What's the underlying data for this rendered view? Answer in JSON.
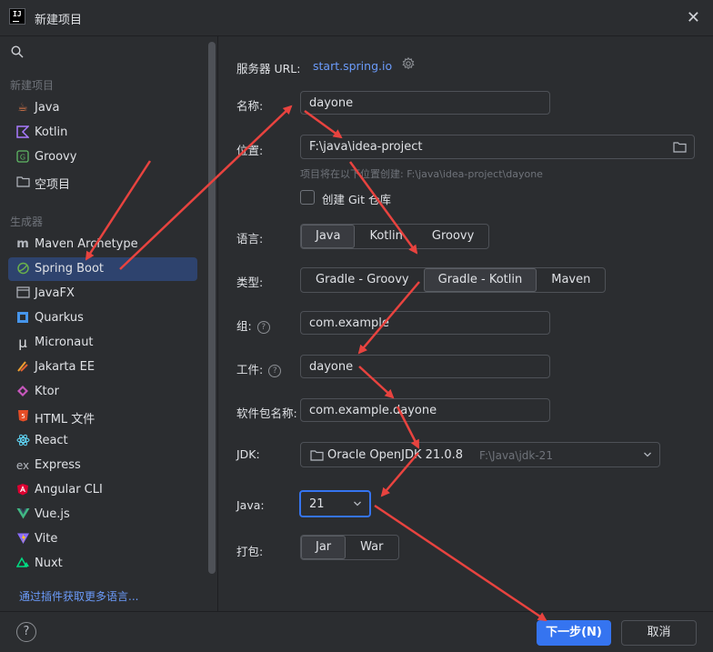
{
  "window": {
    "title": "新建项目",
    "close_icon": "close-icon"
  },
  "sidebar": {
    "section_new": "新建项目",
    "new_items": [
      {
        "label": "Java",
        "icon": "java-cup-icon"
      },
      {
        "label": "Kotlin",
        "icon": "kotlin-icon"
      },
      {
        "label": "Groovy",
        "icon": "groovy-icon"
      },
      {
        "label": "空项目",
        "icon": "empty-project-icon"
      }
    ],
    "section_generators": "生成器",
    "generator_items": [
      {
        "label": "Maven Archetype",
        "icon": "maven-icon"
      },
      {
        "label": "Spring Boot",
        "icon": "spring-icon"
      },
      {
        "label": "JavaFX",
        "icon": "javafx-icon"
      },
      {
        "label": "Quarkus",
        "icon": "quarkus-icon"
      },
      {
        "label": "Micronaut",
        "icon": "micronaut-icon"
      },
      {
        "label": "Jakarta EE",
        "icon": "jakarta-icon"
      },
      {
        "label": "Ktor",
        "icon": "ktor-icon"
      },
      {
        "label": "HTML 文件",
        "icon": "html5-icon"
      },
      {
        "label": "React",
        "icon": "react-icon"
      },
      {
        "label": "Express",
        "icon": "express-icon"
      },
      {
        "label": "Angular CLI",
        "icon": "angular-icon"
      },
      {
        "label": "Vue.js",
        "icon": "vue-icon"
      },
      {
        "label": "Vite",
        "icon": "vite-icon"
      },
      {
        "label": "Nuxt",
        "icon": "nuxt-icon"
      }
    ],
    "selected": "Spring Boot",
    "plugin_link": "通过插件获取更多语言..."
  },
  "form": {
    "server_url_label": "服务器 URL:",
    "server_url": "start.spring.io",
    "name_label": "名称:",
    "name_value": "dayone",
    "location_label": "位置:",
    "location_value": "F:\\java\\idea-project",
    "location_hint": "项目将在以下位置创建: F:\\java\\idea-project\\dayone",
    "git_label": "创建 Git 仓库",
    "git_checked": false,
    "language_label": "语言:",
    "languages": [
      "Java",
      "Kotlin",
      "Groovy"
    ],
    "language_selected": "Java",
    "type_label": "类型:",
    "types": [
      "Gradle - Groovy",
      "Gradle - Kotlin",
      "Maven"
    ],
    "type_selected": "Gradle - Kotlin",
    "group_label": "组:",
    "group_value": "com.example",
    "artifact_label": "工件:",
    "artifact_value": "dayone",
    "package_label": "软件包名称:",
    "package_value": "com.example.dayone",
    "jdk_label": "JDK:",
    "jdk_name": "Oracle OpenJDK 21.0.8",
    "jdk_path": "F:\\Java\\jdk-21",
    "java_label": "Java:",
    "java_value": "21",
    "packaging_label": "打包:",
    "packagings": [
      "Jar",
      "War"
    ],
    "packaging_selected": "Jar"
  },
  "footer": {
    "help": "?",
    "next_label": "下一步(N)",
    "cancel_label": "取消"
  },
  "colors": {
    "accent": "#3574f0",
    "annotation_arrow": "#e8433f",
    "selection": "#2e436e"
  }
}
